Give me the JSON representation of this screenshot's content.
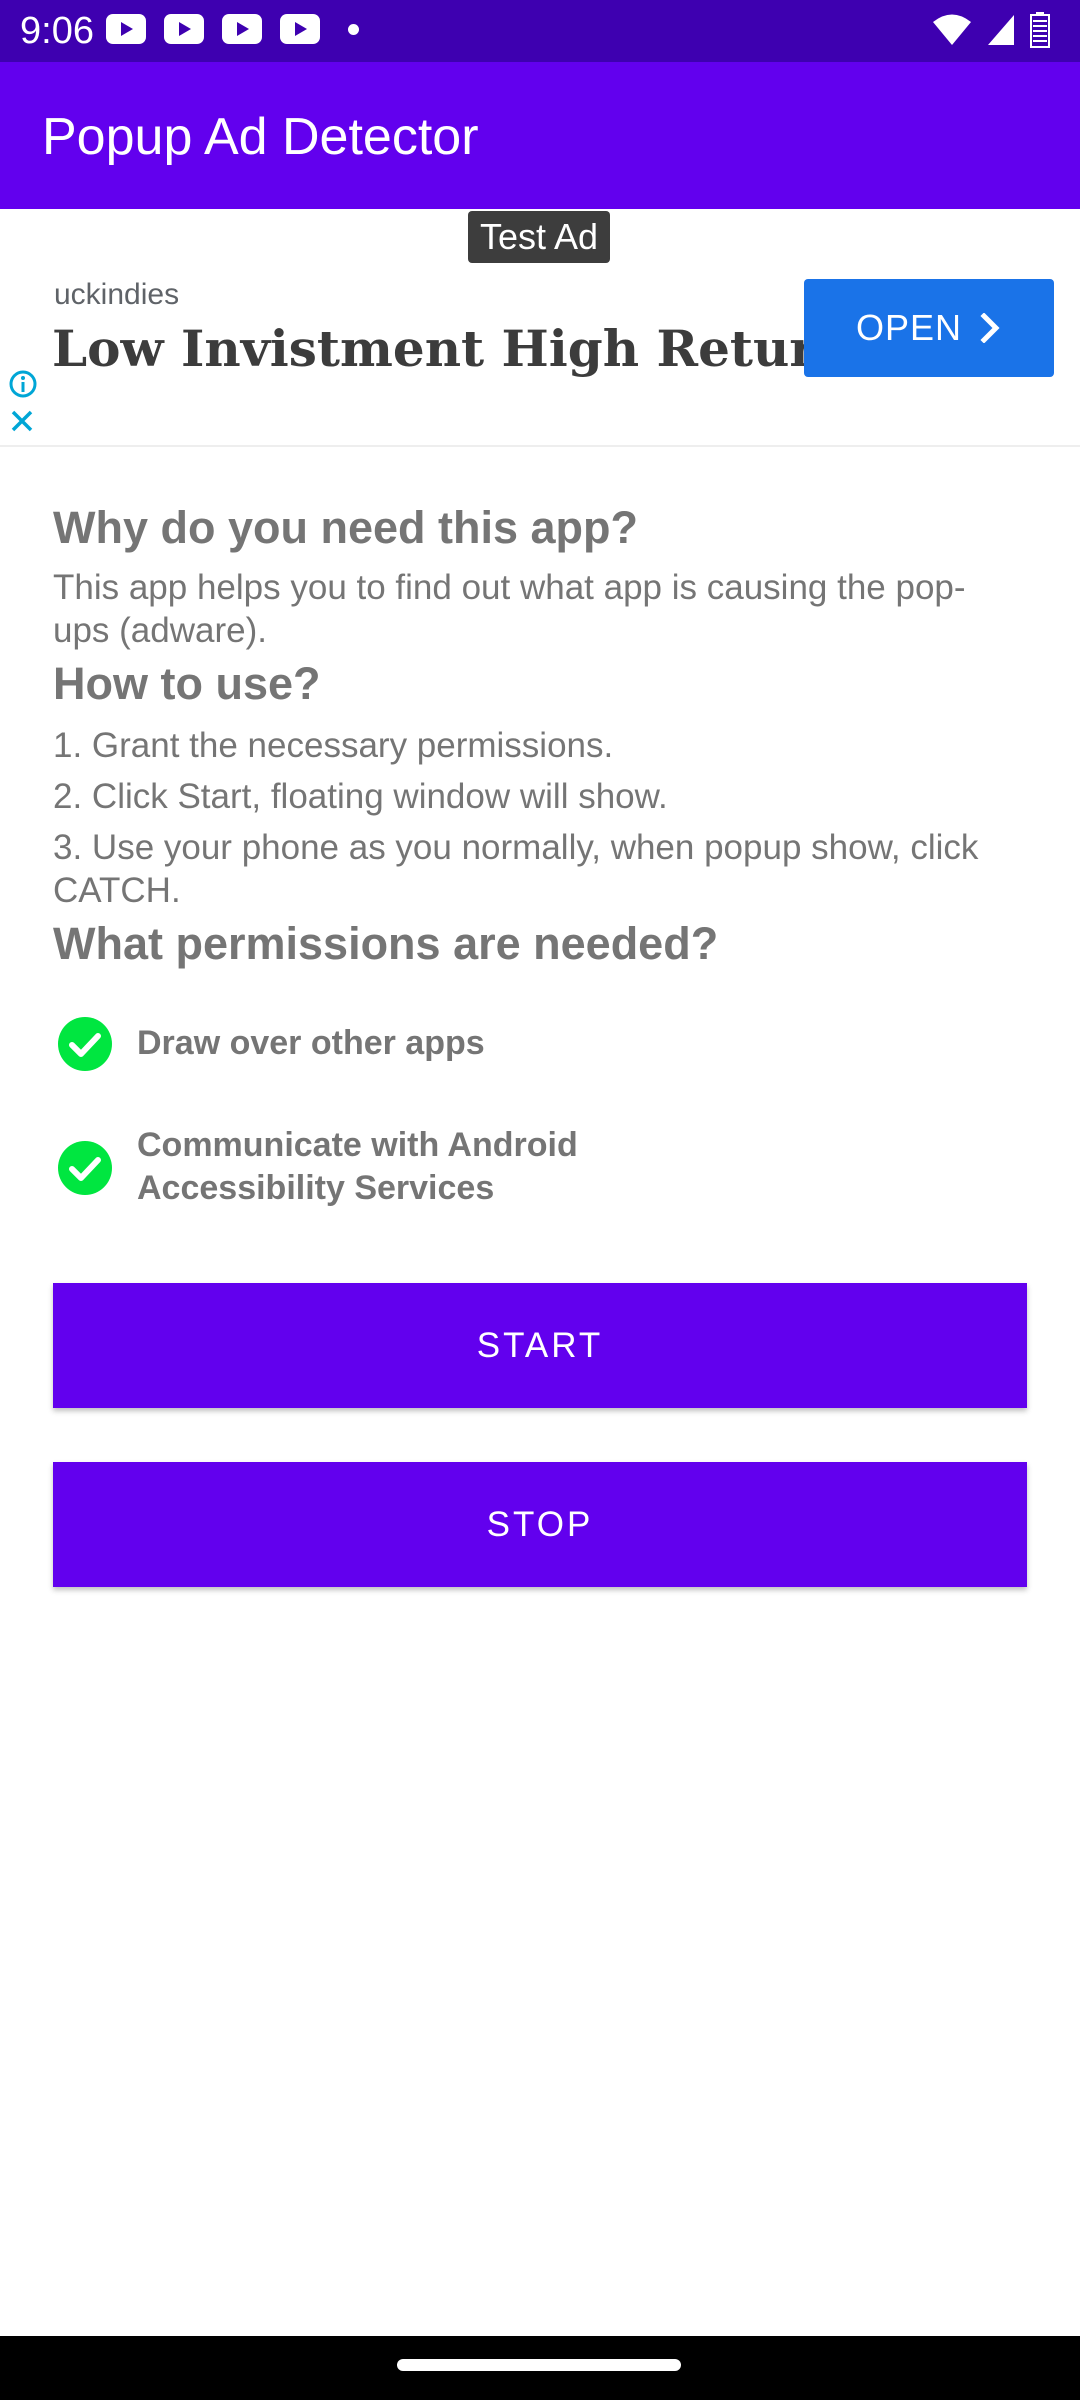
{
  "status_bar": {
    "time": "9:06",
    "left_icons": [
      "youtube-icon",
      "youtube-icon",
      "youtube-icon",
      "youtube-icon",
      "dot-icon"
    ],
    "right_icons": [
      "wifi-icon",
      "signal-icon",
      "battery-icon"
    ]
  },
  "app_bar": {
    "title": "Popup Ad Detector",
    "color": "#6200ee"
  },
  "ad": {
    "badge": "Test Ad",
    "advertiser": "uckindies",
    "headline": "Low Invistment High Return",
    "open_label": "OPEN",
    "icons": [
      "chevron-right-icon",
      "info-icon",
      "close-icon"
    ],
    "button_color": "#1a73e8"
  },
  "content": {
    "why_heading": "Why do you need this app?",
    "why_text": "This app helps you to find out what app is causing the pop-ups (adware).",
    "how_heading": "How to use?",
    "steps": [
      "1. Grant the necessary permissions.",
      "2. Click Start, floating window will show.",
      "3. Use your phone as you normally, when popup show, click CATCH."
    ],
    "permissions_heading": "What permissions are needed?",
    "permissions": [
      {
        "label": "Draw over other apps",
        "granted": true
      },
      {
        "label": "Communicate with Android Accessibility Services",
        "granted": true
      }
    ],
    "check_color": "#00e640"
  },
  "buttons": {
    "start_label": "START",
    "stop_label": "STOP",
    "color": "#6200ee"
  }
}
